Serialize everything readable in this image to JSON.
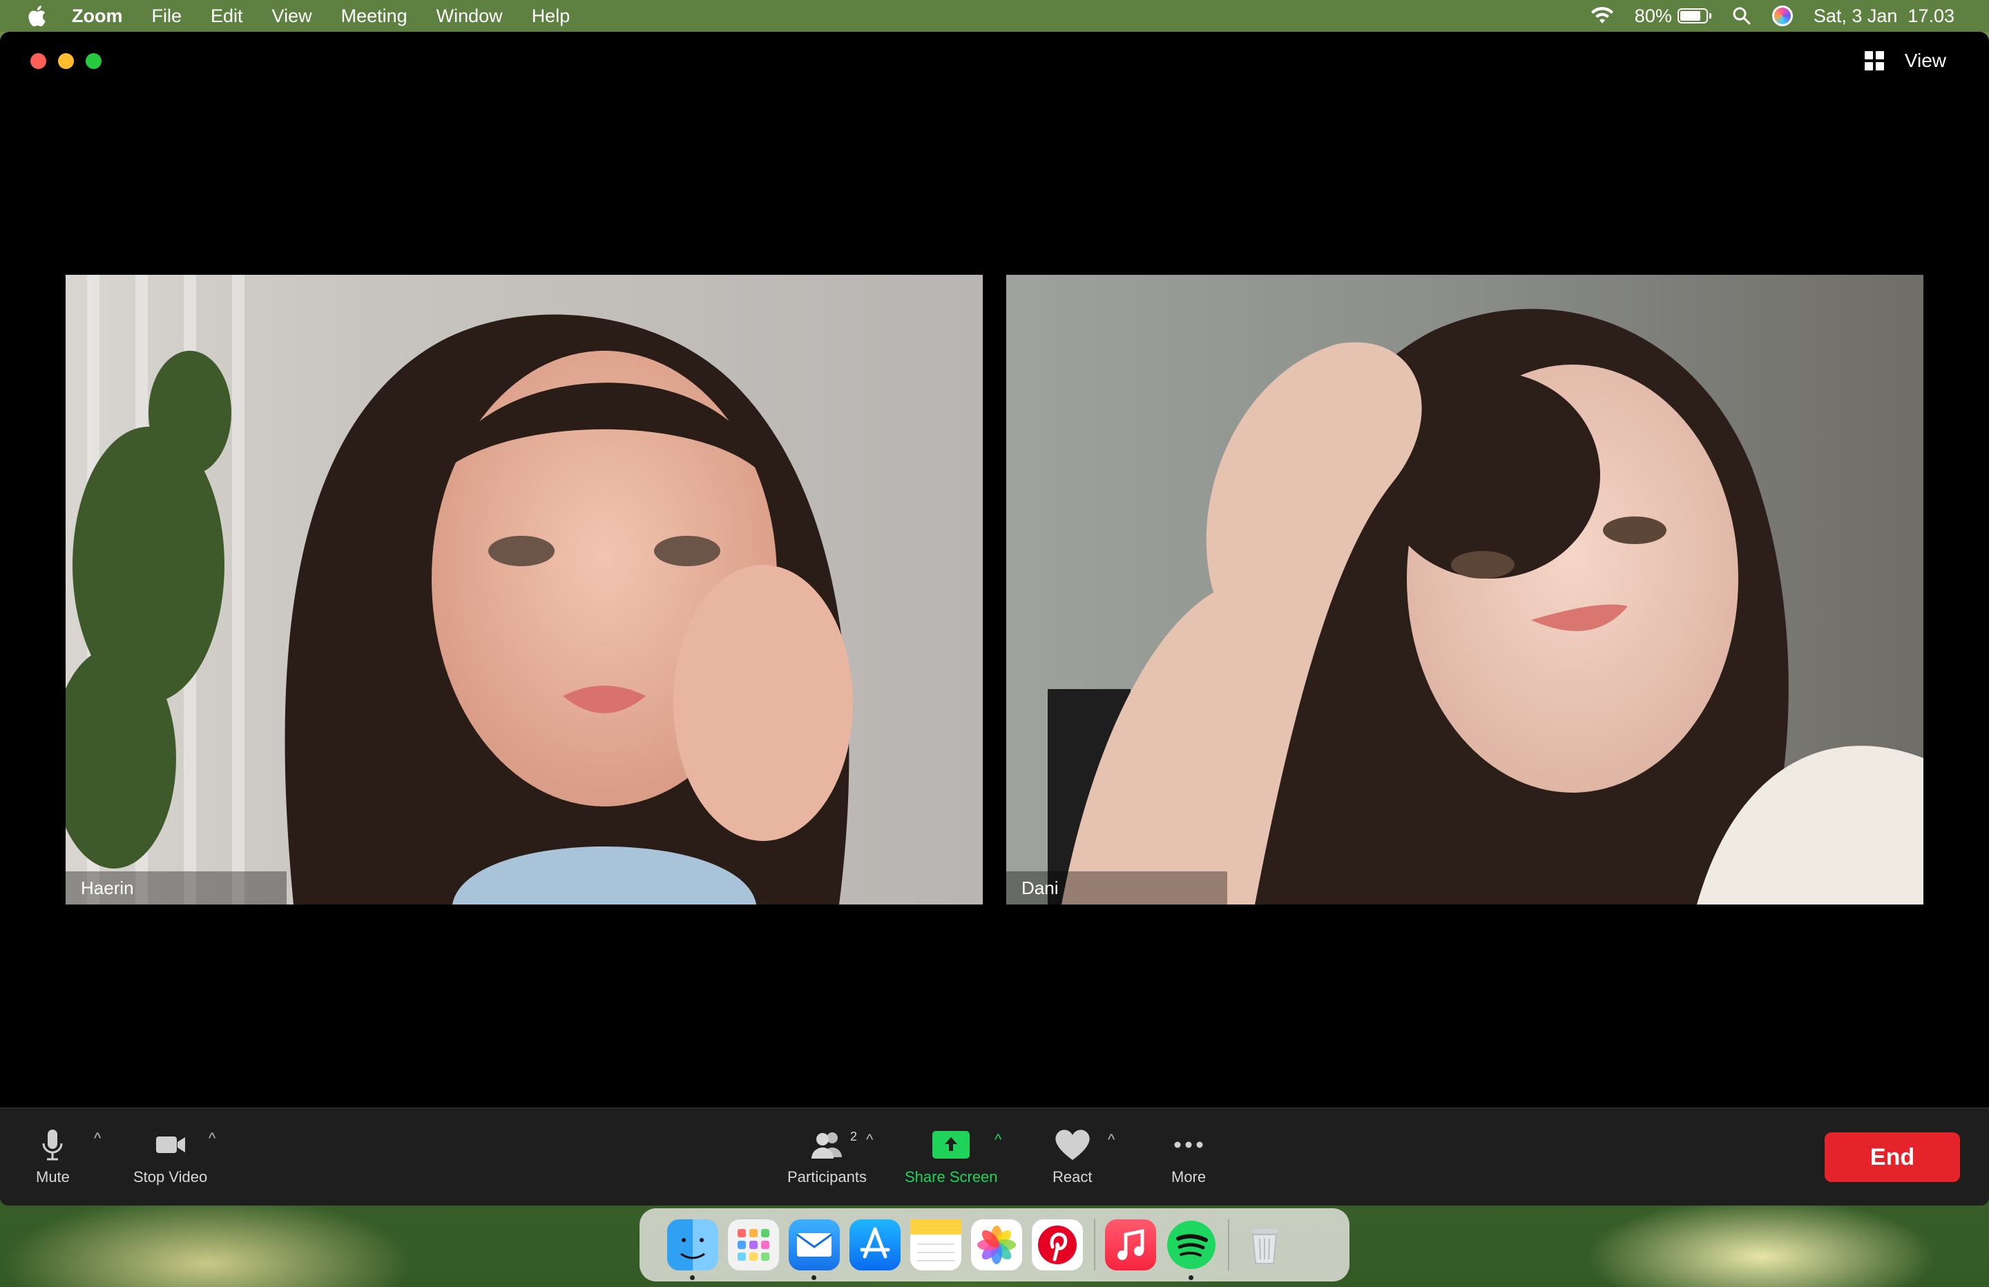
{
  "menubar": {
    "app_name": "Zoom",
    "items": [
      "File",
      "Edit",
      "View",
      "Meeting",
      "Window",
      "Help"
    ],
    "battery_percent": "80%",
    "battery_level": 0.8,
    "datetime": "Sat, 3 Jan  17.03"
  },
  "window": {
    "view_label": "View"
  },
  "participants": [
    {
      "name": "Haerin"
    },
    {
      "name": "Dani"
    }
  ],
  "controls": {
    "mute_label": "Mute",
    "stop_video_label": "Stop Video",
    "participants_label": "Participants",
    "participants_count": "2",
    "share_screen_label": "Share Screen",
    "react_label": "React",
    "more_label": "More",
    "end_label": "End",
    "share_color": "#1fd35a",
    "end_color": "#e5232a"
  },
  "dock": {
    "apps": [
      "finder-icon",
      "launchpad-icon",
      "mail-icon",
      "app-store-icon",
      "notes-icon",
      "photos-icon",
      "pinterest-icon",
      "music-icon",
      "spotify-icon",
      "trash-icon"
    ]
  }
}
